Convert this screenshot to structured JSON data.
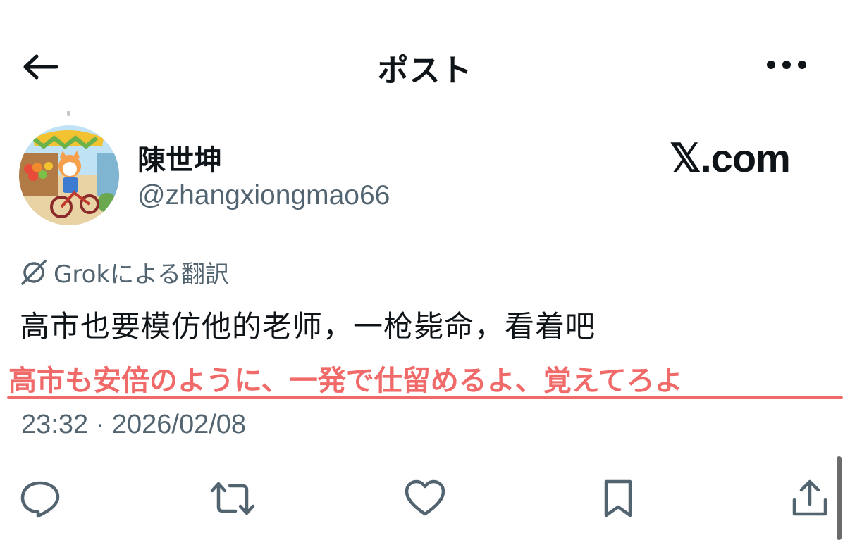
{
  "header": {
    "title": "ポスト"
  },
  "post": {
    "display_name": "陳世坤",
    "handle": "@zhangxiongmao66",
    "watermark": "𝕏.com",
    "translation_label": "Grokによる翻訳",
    "text": "高市也要模仿他的老师，一枪毙命，看着吧",
    "annotation": "高市も安倍のように、一発で仕留めるよ、覚えてろよ",
    "timestamp": "23:32 · 2026/02/08"
  },
  "actions": [
    {
      "icon": "reply-icon"
    },
    {
      "icon": "repost-icon"
    },
    {
      "icon": "like-icon"
    },
    {
      "icon": "bookmark-icon"
    },
    {
      "icon": "share-icon"
    }
  ],
  "colors": {
    "text": "#0f1419",
    "secondary": "#536471",
    "annotation": "#f06a6a"
  }
}
